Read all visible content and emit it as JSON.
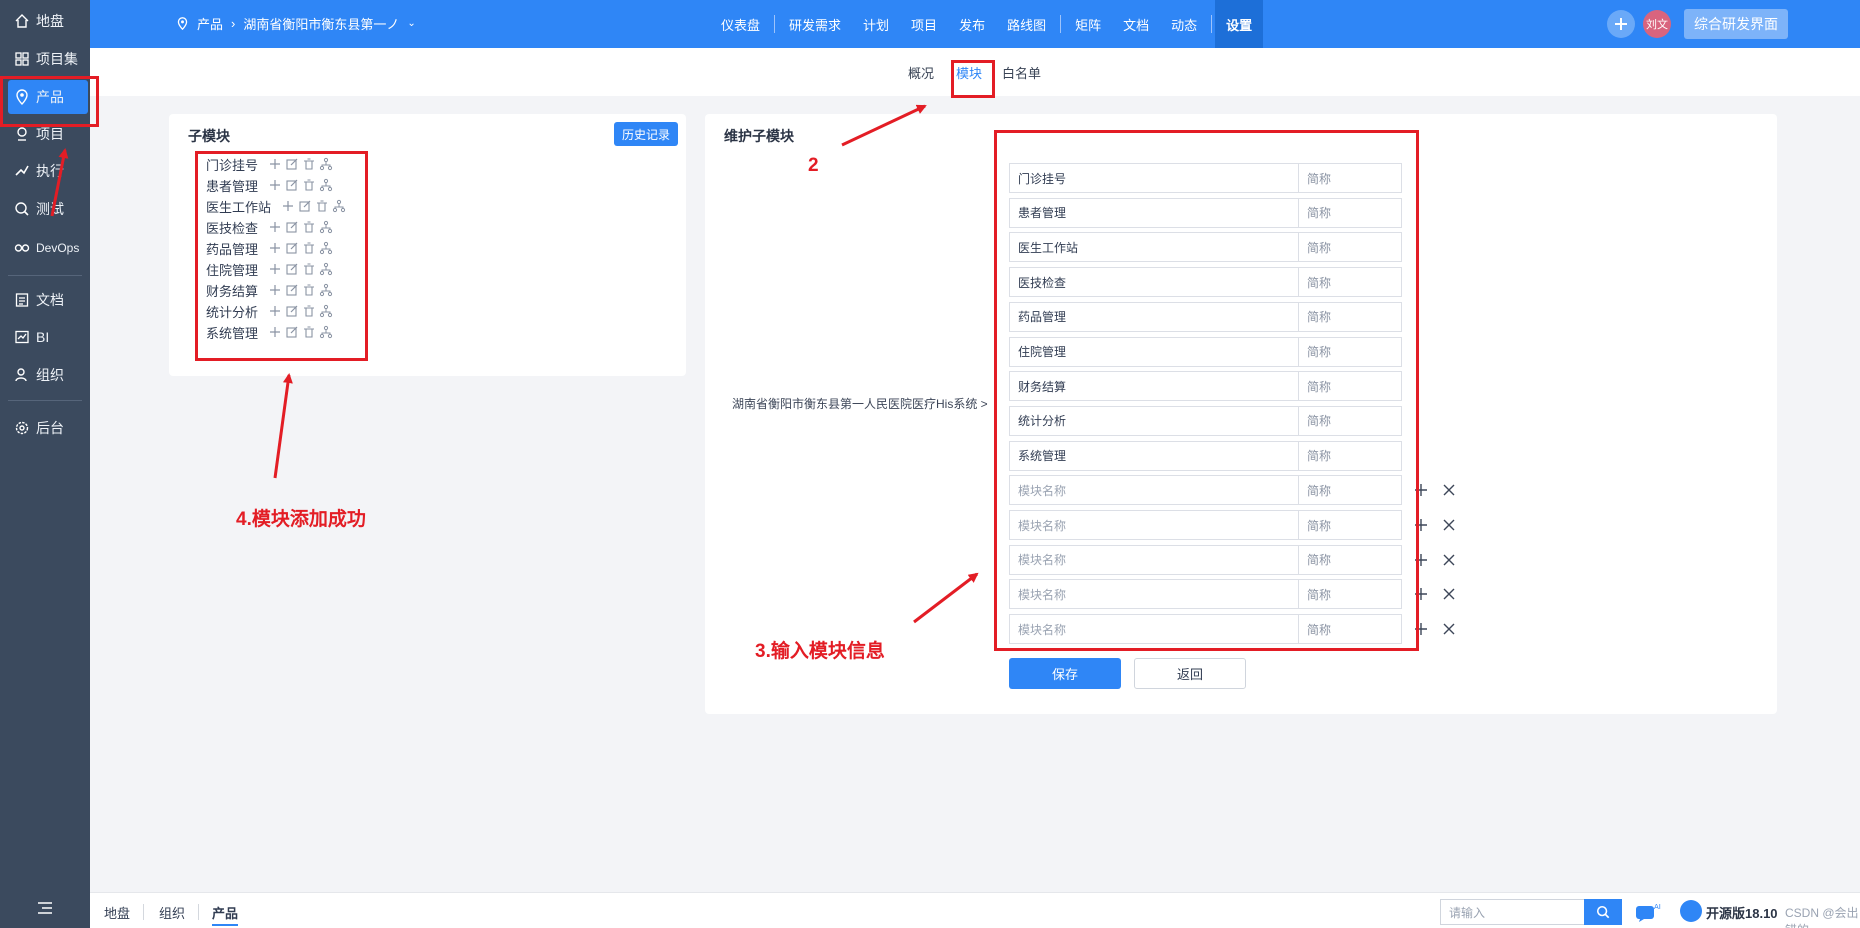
{
  "sidebar": {
    "items": [
      {
        "label": "地盘",
        "icon": "home-icon"
      },
      {
        "label": "项目集",
        "icon": "grid-icon"
      },
      {
        "label": "产品",
        "icon": "product-icon"
      },
      {
        "label": "项目",
        "icon": "project-icon"
      },
      {
        "label": "执行",
        "icon": "run-icon"
      },
      {
        "label": "测试",
        "icon": "test-icon"
      },
      {
        "label": "DevOps",
        "icon": "infinity-icon"
      },
      {
        "label": "文档",
        "icon": "doc-icon"
      },
      {
        "label": "BI",
        "icon": "chart-icon"
      },
      {
        "label": "组织",
        "icon": "org-icon"
      },
      {
        "label": "后台",
        "icon": "gear-icon"
      }
    ]
  },
  "topbar": {
    "breadcrumb_root": "产品",
    "breadcrumb_product": "湖南省衡阳市衡东县第一ノ",
    "nav": [
      "仪表盘",
      "研发需求",
      "计划",
      "项目",
      "发布",
      "路线图",
      "矩阵",
      "文档",
      "动态",
      "设置"
    ],
    "active_nav": "设置",
    "avatar_text": "刘文",
    "workspace_label": "综合研发界面"
  },
  "subtabs": {
    "items": [
      "概况",
      "模块",
      "白名单"
    ],
    "active": "模块"
  },
  "left_panel": {
    "title": "子模块",
    "history_button": "历史记录",
    "modules": [
      "门诊挂号",
      "患者管理",
      "医生工作站",
      "医技检查",
      "药品管理",
      "住院管理",
      "财务结算",
      "统计分析",
      "系统管理"
    ]
  },
  "right_panel": {
    "title": "维护子模块",
    "product_path": "湖南省衡阳市衡东县第一人民医院医疗His系统 >",
    "existing_rows": [
      {
        "name": "门诊挂号",
        "short": "简称"
      },
      {
        "name": "患者管理",
        "short": "简称"
      },
      {
        "name": "医生工作站",
        "short": "简称"
      },
      {
        "name": "医技检查",
        "short": "简称"
      },
      {
        "name": "药品管理",
        "short": "简称"
      },
      {
        "name": "住院管理",
        "short": "简称"
      },
      {
        "name": "财务结算",
        "short": "简称"
      },
      {
        "name": "统计分析",
        "short": "简称"
      },
      {
        "name": "系统管理",
        "short": "简称"
      }
    ],
    "new_rows": [
      {
        "name_placeholder": "模块名称",
        "short_placeholder": "简称"
      },
      {
        "name_placeholder": "模块名称",
        "short_placeholder": "简称"
      },
      {
        "name_placeholder": "模块名称",
        "short_placeholder": "简称"
      },
      {
        "name_placeholder": "模块名称",
        "short_placeholder": "简称"
      },
      {
        "name_placeholder": "模块名称",
        "short_placeholder": "简称"
      }
    ],
    "save_button": "保存",
    "back_button": "返回"
  },
  "annotations": {
    "label_2": "2",
    "label_3": "3.输入模块信息",
    "label_4": "4.模块添加成功",
    "color": "#e31d25"
  },
  "bottombar": {
    "tabs": [
      "地盘",
      "组织",
      "产品"
    ],
    "active_tab": "产品",
    "search_placeholder": "请输入",
    "edition": "开源版18.10",
    "watermark": "CSDN @会出错的"
  },
  "colors": {
    "primary": "#2f86f6",
    "sidebar": "#3b4a5e"
  }
}
